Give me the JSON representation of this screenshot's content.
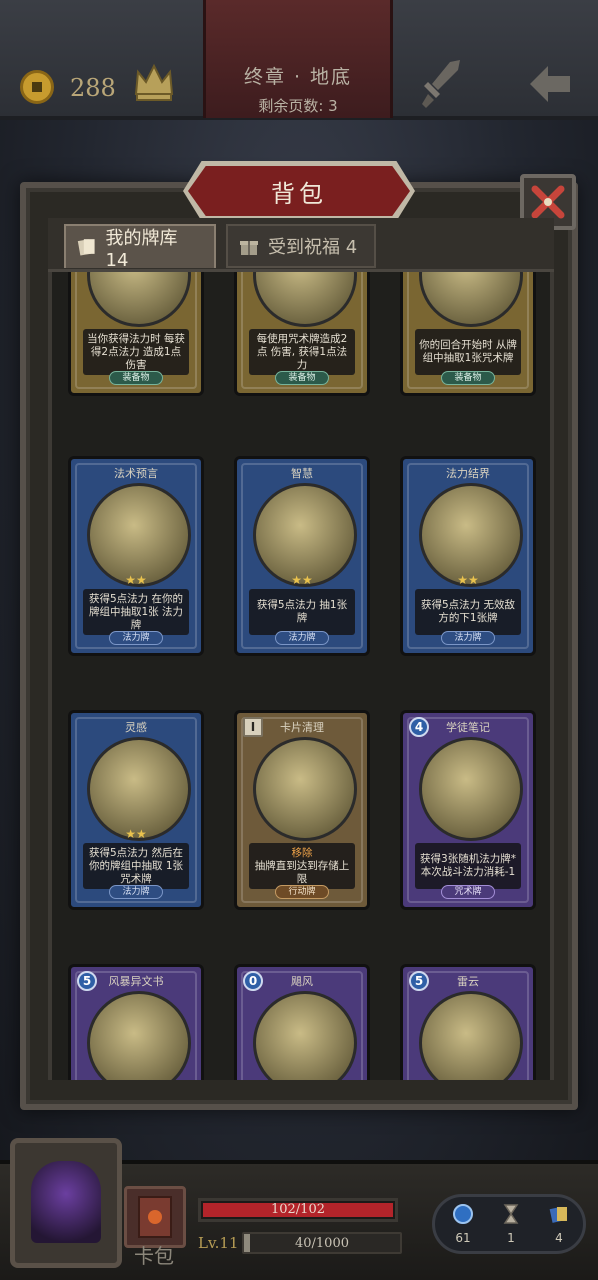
{
  "header": {
    "coins": "288",
    "chapter_title": "终章 · 地底",
    "pages_left": "剩余页数: 3"
  },
  "panel": {
    "title": "背包",
    "tabs": [
      {
        "label": "我的牌库 14"
      },
      {
        "label": "受到祝福 4"
      }
    ]
  },
  "cards": [
    {
      "name": "",
      "desc": "当你获得法力时 每获得2点法力 造成1点伤害",
      "type": "装备物",
      "cost": ""
    },
    {
      "name": "",
      "desc": "每使用咒术牌造成2点 伤害, 获得1点法力",
      "type": "装备物",
      "cost": ""
    },
    {
      "name": "",
      "desc": "你的回合开始时 从牌组中抽取1张咒术牌",
      "type": "装备物",
      "cost": ""
    },
    {
      "name": "法术预言",
      "desc": "获得5点法力 在你的牌组中抽取1张 法力牌",
      "type": "法力牌",
      "cost": ""
    },
    {
      "name": "智慧",
      "desc": "获得5点法力 抽1张牌",
      "type": "法力牌",
      "cost": ""
    },
    {
      "name": "法力结界",
      "desc": "获得5点法力 无效敌方的下1张牌",
      "type": "法力牌",
      "cost": ""
    },
    {
      "name": "灵感",
      "desc": "获得5点法力 然后在你的牌组中抽取 1张咒术牌",
      "type": "法力牌",
      "cost": ""
    },
    {
      "name": "卡片清理",
      "desc_accent": "移除",
      "desc": "抽牌直到达到存储上限",
      "type": "行动牌",
      "cost": "I"
    },
    {
      "name": "学徒笔记",
      "desc": "获得3张随机法力牌* 本次战斗法力消耗-1",
      "type": "咒术牌",
      "cost": "4"
    },
    {
      "name": "风暴异文书",
      "desc": "",
      "type": "",
      "cost": "5"
    },
    {
      "name": "飓风",
      "desc": "",
      "type": "",
      "cost": "0"
    },
    {
      "name": "雷云",
      "desc": "",
      "type": "",
      "cost": "5"
    }
  ],
  "footer": {
    "deck_label": "卡包",
    "hp": "102/102",
    "hp_fraction": 1.0,
    "level": "Lv.11",
    "xp": "40/1000",
    "xp_fraction": 0.04,
    "stats": [
      {
        "icon": "mana-orb-icon",
        "value": "61"
      },
      {
        "icon": "hourglass-icon",
        "value": "1"
      },
      {
        "icon": "cards-icon",
        "value": "4"
      }
    ]
  },
  "colors": {
    "accent_red": "#7a1f1f",
    "gold": "#c79b2e",
    "mana_blue": "#2c4a7d"
  }
}
